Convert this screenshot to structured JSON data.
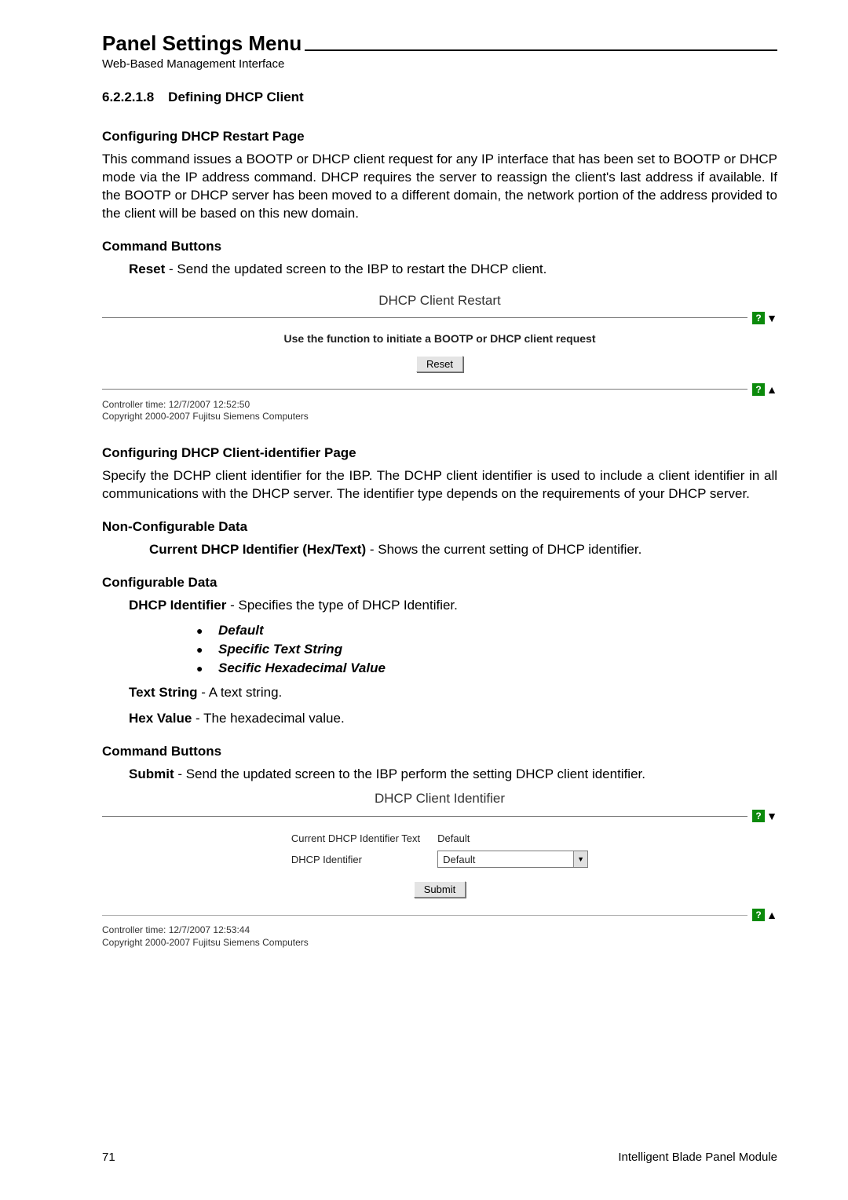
{
  "header": {
    "title": "Panel Settings Menu",
    "subtitle": "Web-Based Management Interface"
  },
  "sec_num": "6.2.2.1.8",
  "sec_title": "Defining DHCP Client",
  "restart": {
    "heading": "Configuring DHCP Restart Page",
    "para": "This command issues a BOOTP or DHCP client request for any IP interface that has been set to BOOTP or DHCP mode via the IP address command. DHCP requires the server to reassign the client's last address if available. If the BOOTP or DHCP server has been moved to a different domain, the network portion of the address provided to the client will be based on this new domain.",
    "cmd_heading": "Command Buttons",
    "reset_label": "Reset",
    "reset_desc": " - Send the updated screen to the IBP to restart the DHCP client."
  },
  "shot1": {
    "title": "DHCP Client Restart",
    "hint": "Use the function to initiate a BOOTP or DHCP client request",
    "button": "Reset",
    "time": "Controller time: 12/7/2007 12:52:50",
    "copyright": "Copyright 2000-2007 Fujitsu Siemens Computers"
  },
  "ident": {
    "heading": "Configuring DHCP Client-identifier Page",
    "para": "Specify the DCHP client identifier for the IBP. The DCHP client identifier is used to include a client identifier in all communications with the DHCP server. The identifier type depends on the requirements of your DHCP server.",
    "noncfg_heading": "Non-Configurable Data",
    "current_label": "Current DHCP Identifier (Hex/Text)",
    "current_desc": " - Shows the current setting of DHCP identifier.",
    "cfg_heading": "Configurable Data",
    "dhcp_id_label": "DHCP Identifier",
    "dhcp_id_desc": " - Specifies the type of DHCP Identifier.",
    "bullets": [
      "Default",
      "Specific Text String",
      "Secific Hexadecimal Value"
    ],
    "text_string_label": "Text String",
    "text_string_desc": " - A text string.",
    "hex_label": "Hex Value",
    "hex_desc": " - The hexadecimal value.",
    "cmd_heading": "Command Buttons",
    "submit_label": "Submit",
    "submit_desc": " - Send the updated screen to the IBP perform the setting DHCP client identifier."
  },
  "shot2": {
    "title": "DHCP Client Identifier",
    "row1_label": "Current DHCP Identifier Text",
    "row1_value": "Default",
    "row2_label": "DHCP Identifier",
    "row2_value": "Default",
    "button": "Submit",
    "time": "Controller time: 12/7/2007 12:53:44",
    "copyright": "Copyright 2000-2007 Fujitsu Siemens Computers"
  },
  "footer": {
    "page": "71",
    "product": "Intelligent Blade Panel Module"
  }
}
